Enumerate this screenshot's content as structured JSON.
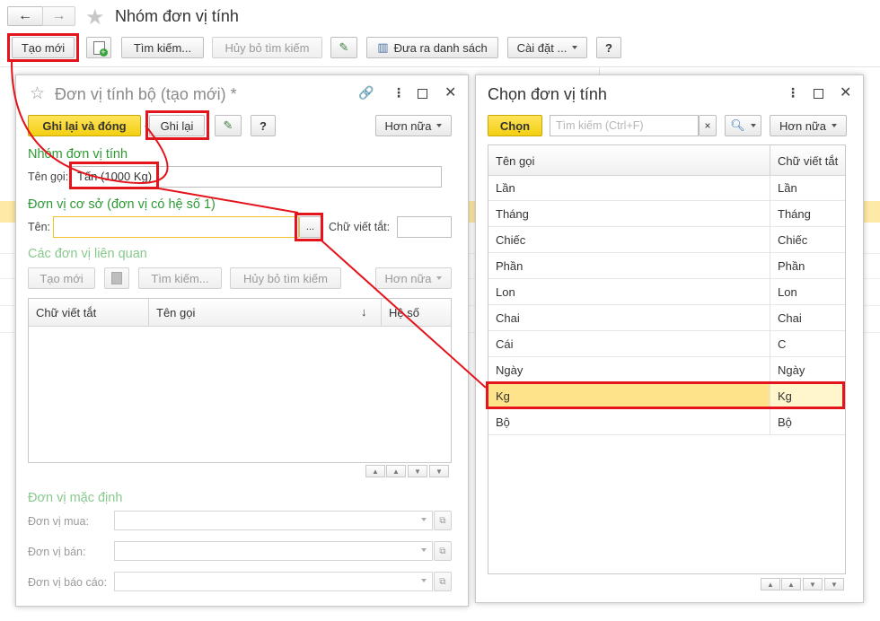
{
  "window": {
    "title": "Nhóm đơn vị tính",
    "toolbar": {
      "create": "Tạo mới",
      "search": "Tìm kiếm...",
      "cancel_search": "Hủy bỏ tìm kiếm",
      "export_list": "Đưa ra danh sách",
      "settings": "Cài đặt ...",
      "help": "?"
    }
  },
  "form": {
    "title": "Đơn vị tính bộ (tạo mới) *",
    "toolbar": {
      "save_close": "Ghi lại và đóng",
      "save": "Ghi lại",
      "help": "?",
      "more": "Hơn nữa"
    },
    "group_section": "Nhóm đơn vị tính",
    "name_label": "Tên gọi:",
    "name_value": "Tấn (1000 Kg)",
    "base_unit_section": "Đơn vị cơ sở (đơn vị có hệ số 1)",
    "base_name_label": "Tên:",
    "base_name_value": "",
    "select_button": "...",
    "abbr_label": "Chữ viết tắt:",
    "abbr_value": "",
    "related_section": "Các đơn vị liên quan",
    "related_toolbar": {
      "create": "Tạo mới",
      "search": "Tìm kiếm...",
      "cancel_search": "Hủy bỏ tìm kiếm",
      "more": "Hơn nữa"
    },
    "related_table": {
      "col_abbr": "Chữ viết tắt",
      "col_name": "Tên gọi",
      "col_factor": "Hệ số",
      "sort_arrow": "↓",
      "rows": []
    },
    "default_section": "Đơn vị mặc định",
    "purchase_label": "Đơn vị mua:",
    "sale_label": "Đơn vị bán:",
    "report_label": "Đơn vị báo cáo:"
  },
  "chooser": {
    "title": "Chọn đơn vị tính",
    "choose_button": "Chọn",
    "search_placeholder": "Tìm kiếm (Ctrl+F)",
    "clear": "×",
    "more": "Hơn nữa",
    "col_name": "Tên gọi",
    "col_abbr": "Chữ viết tắt",
    "rows": [
      {
        "name": "Lần",
        "abbr": "Lần"
      },
      {
        "name": "Tháng",
        "abbr": "Tháng"
      },
      {
        "name": "Chiếc",
        "abbr": "Chiếc"
      },
      {
        "name": "Phần",
        "abbr": "Phần"
      },
      {
        "name": "Lon",
        "abbr": "Lon"
      },
      {
        "name": "Chai",
        "abbr": "Chai"
      },
      {
        "name": "Cái",
        "abbr": "C"
      },
      {
        "name": "Ngày",
        "abbr": "Ngày"
      },
      {
        "name": "Kg",
        "abbr": "Kg"
      },
      {
        "name": "Bộ",
        "abbr": "Bộ"
      }
    ],
    "selected_index": 8
  },
  "colors": {
    "accent_yellow": "#f3cf12",
    "section_green": "#2e9a35",
    "highlight_red": "#e3141b",
    "selected_row": "#ffe38a"
  }
}
